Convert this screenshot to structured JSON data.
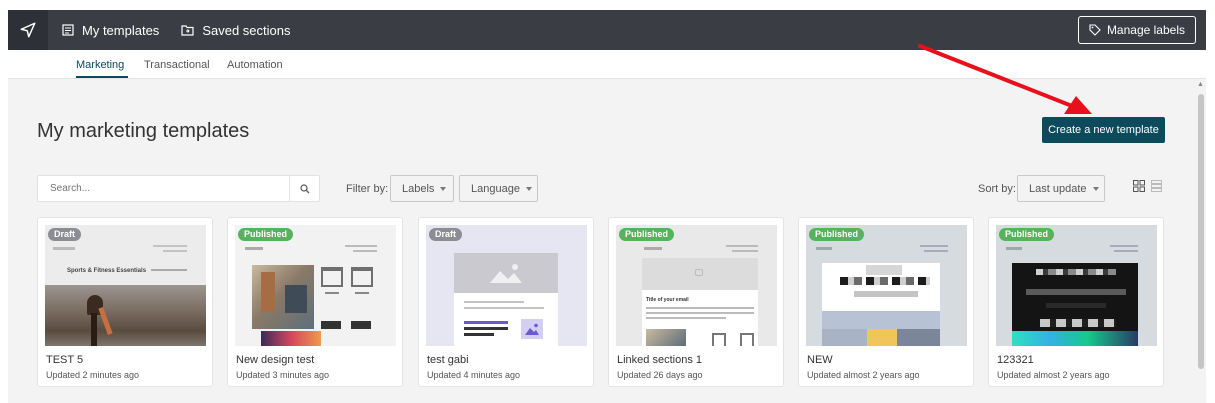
{
  "topbar": {
    "nav": [
      {
        "label": "My templates",
        "icon": "template-icon"
      },
      {
        "label": "Saved sections",
        "icon": "folder-icon"
      }
    ],
    "manage_labels": "Manage labels"
  },
  "tabs": [
    {
      "label": "Marketing",
      "active": true
    },
    {
      "label": "Transactional",
      "active": false
    },
    {
      "label": "Automation",
      "active": false
    }
  ],
  "page": {
    "title": "My marketing templates",
    "create_button": "Create a new template"
  },
  "search": {
    "placeholder": "Search..."
  },
  "filter": {
    "label": "Filter by:",
    "labels_dropdown": "Labels",
    "language_dropdown": "Language"
  },
  "sort": {
    "label": "Sort by:",
    "value": "Last update"
  },
  "templates": [
    {
      "name": "TEST 5",
      "updated": "Updated 2 minutes ago",
      "status": "Draft",
      "thumb_text": "Sports & Fitness Essentials"
    },
    {
      "name": "New design test",
      "updated": "Updated 3 minutes ago",
      "status": "Published"
    },
    {
      "name": "test gabi",
      "updated": "Updated 4 minutes ago",
      "status": "Draft"
    },
    {
      "name": "Linked sections 1",
      "updated": "Updated 26 days ago",
      "status": "Published",
      "thumb_text": "Title of your email"
    },
    {
      "name": "NEW",
      "updated": "Updated almost 2 years ago",
      "status": "Published"
    },
    {
      "name": "123321",
      "updated": "Updated almost 2 years ago",
      "status": "Published"
    }
  ],
  "colors": {
    "topbar": "#3b3d45",
    "primary": "#0c4a5c",
    "draft_badge": "#8b8d92",
    "published_badge": "#56b25c",
    "annotation_arrow": "#e8111b"
  }
}
